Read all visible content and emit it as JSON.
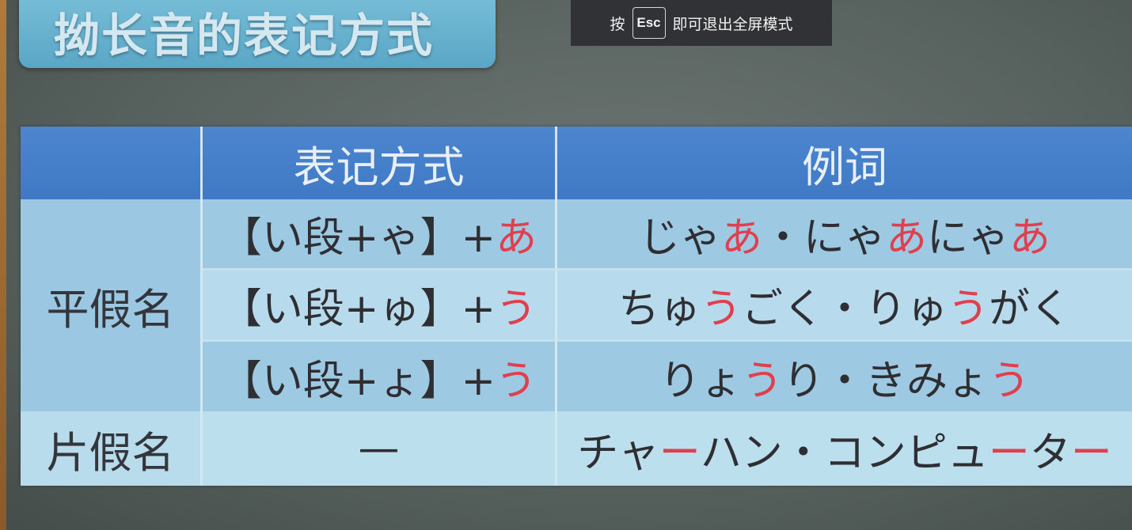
{
  "title": "拗长音的表记方式",
  "esc_notice": {
    "prefix": "按",
    "key": "Esc",
    "suffix": "即可退出全屏模式"
  },
  "table": {
    "headers": [
      "",
      "表记方式",
      "例词"
    ],
    "groups": [
      {
        "label": "平假名"
      },
      {
        "label": "片假名"
      }
    ],
    "rows": [
      {
        "method": [
          {
            "t": "【い段+ゃ】+",
            "red": false
          },
          {
            "t": "あ",
            "red": true
          }
        ],
        "example": [
          {
            "t": "じゃ",
            "red": false
          },
          {
            "t": "あ",
            "red": true
          },
          {
            "t": "・にゃ",
            "red": false
          },
          {
            "t": "あ",
            "red": true
          },
          {
            "t": "にゃ",
            "red": false
          },
          {
            "t": "あ",
            "red": true
          }
        ]
      },
      {
        "method": [
          {
            "t": "【い段+ゅ】+",
            "red": false
          },
          {
            "t": "う",
            "red": true
          }
        ],
        "example": [
          {
            "t": "ちゅ",
            "red": false
          },
          {
            "t": "う",
            "red": true
          },
          {
            "t": "ごく・りゅ",
            "red": false
          },
          {
            "t": "う",
            "red": true
          },
          {
            "t": "がく",
            "red": false
          }
        ]
      },
      {
        "method": [
          {
            "t": "【い段+ょ】+",
            "red": false
          },
          {
            "t": "う",
            "red": true
          }
        ],
        "example": [
          {
            "t": "りょ",
            "red": false
          },
          {
            "t": "う",
            "red": true
          },
          {
            "t": "り・きみょ",
            "red": false
          },
          {
            "t": "う",
            "red": true
          }
        ]
      },
      {
        "method": [
          {
            "t": "—",
            "red": false
          }
        ],
        "example": [
          {
            "t": "チャ",
            "red": false
          },
          {
            "t": "ー",
            "red": true
          },
          {
            "t": "ハン・コンピュ",
            "red": false
          },
          {
            "t": "ー",
            "red": true
          },
          {
            "t": "タ",
            "red": false
          },
          {
            "t": "ー",
            "red": true
          }
        ]
      }
    ]
  },
  "colors": {
    "header_blue": "#4a82cc",
    "highlight_red": "#e0404e",
    "banner_teal": "#6db4d1"
  }
}
